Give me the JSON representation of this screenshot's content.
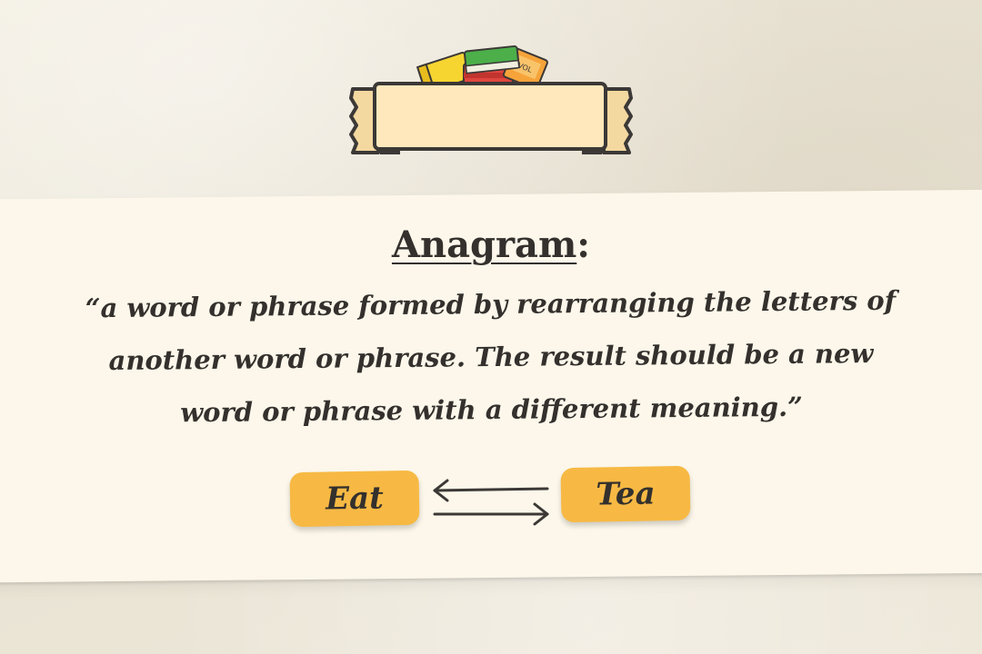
{
  "definition": {
    "term": "Anagram",
    "colon": ":",
    "quote": "“a word or phrase formed by rearranging the letters of another word or phrase. The result should be a new word or phrase with a different meaning.”"
  },
  "example": {
    "from": "Eat",
    "to": "Tea"
  },
  "icons": {
    "books": "books-icon",
    "swap": "swap-arrows-icon"
  },
  "colors": {
    "background": "#efe9dc",
    "paper": "#fcf7ea",
    "banner_fill": "#ffe8bc",
    "banner_ribbon": "#f3d8a0",
    "outline": "#3b3836",
    "pill": "#f7b944",
    "text": "#33302d"
  }
}
